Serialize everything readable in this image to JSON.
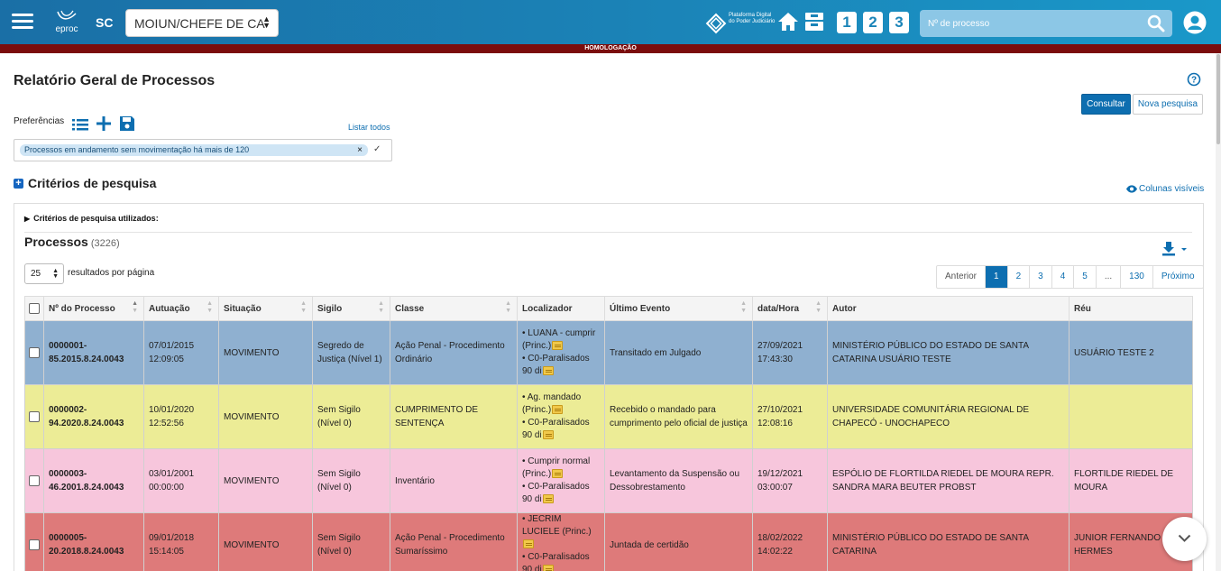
{
  "header": {
    "logo_text": "eproc",
    "uf": "SC",
    "profile_select": "MOIUN/CHEFE DE CA",
    "pdpj_text": "Plataforma Digital do Poder Judiciário",
    "shortcuts": [
      "1",
      "2",
      "3"
    ],
    "search_placeholder": "Nº de processo",
    "environment_banner": "HOMOLOGAÇÃO"
  },
  "page": {
    "title": "Relatório Geral de Processos",
    "consultar_label": "Consultar",
    "nova_pesquisa_label": "Nova pesquisa",
    "preferencias_label": "Preferências",
    "listar_todos": "Listar todos",
    "selected_preference": "Processos em andamento sem movimentação há mais de 120",
    "criterios_title": "Critérios de pesquisa",
    "colunas_visiveis": "Colunas visíveis",
    "criterios_utilizados": "Critérios de pesquisa utilizados:"
  },
  "list": {
    "title": "Processos",
    "count": "(3226)",
    "page_size": "25",
    "page_size_label": "resultados por página",
    "pagination": [
      "Anterior",
      "1",
      "2",
      "3",
      "4",
      "5",
      "...",
      "130",
      "Próximo"
    ],
    "active_page": "1"
  },
  "table": {
    "columns": [
      "Nº do Processo",
      "Autuação",
      "Situação",
      "Sigilo",
      "Classe",
      "Localizador",
      "Último Evento",
      "data/Hora",
      "Autor",
      "Réu"
    ],
    "rows": [
      {
        "color": "#8fb0d0",
        "numero": [
          "0000001-",
          "85.2015.8.24.0043"
        ],
        "autuacao": [
          "07/01/2015",
          "12:09:05"
        ],
        "situacao": "MOVIMENTO",
        "sigilo": "Segredo de Justiça (Nível 1)",
        "classe": "Ação Penal - Procedimento Ordinário",
        "localizador": [
          "• LUANA - cumprir (Princ.)",
          "• C0-Paralisados 90 di"
        ],
        "evento": "Transitado em Julgado",
        "datahora": [
          "27/09/2021",
          "17:43:30"
        ],
        "autor": "MINISTÉRIO PÚBLICO DO ESTADO DE SANTA CATARINA USUÁRIO TESTE",
        "reu": "USUÁRIO TESTE 2"
      },
      {
        "color": "#ecec96",
        "numero": [
          "0000002-",
          "94.2020.8.24.0043"
        ],
        "autuacao": [
          "10/01/2020",
          "12:52:56"
        ],
        "situacao": "MOVIMENTO",
        "sigilo": "Sem Sigilo (Nível 0)",
        "classe": "CUMPRIMENTO DE SENTENÇA",
        "localizador": [
          "• Ag. mandado (Princ.)",
          "• C0-Paralisados 90 di"
        ],
        "evento": "Recebido o mandado para cumprimento pelo oficial de justiça",
        "datahora": [
          "27/10/2021",
          "12:08:16"
        ],
        "autor": "UNIVERSIDADE COMUNITÁRIA REGIONAL DE CHAPECÓ - UNOCHAPECO",
        "reu": ""
      },
      {
        "color": "#f7c6dc",
        "numero": [
          "0000003-",
          "46.2001.8.24.0043"
        ],
        "autuacao": [
          "03/01/2001",
          "00:00:00"
        ],
        "situacao": "MOVIMENTO",
        "sigilo": "Sem Sigilo (Nível 0)",
        "classe": "Inventário",
        "localizador": [
          "• Cumprir normal (Princ.)",
          "• C0-Paralisados 90 di"
        ],
        "evento": "Levantamento da Suspensão ou Dessobrestamento",
        "datahora": [
          "19/12/2021",
          "03:00:07"
        ],
        "autor": "ESPÓLIO DE FLORTILDA RIEDEL DE MOURA REPR. SANDRA MARA BEUTER PROBST",
        "reu": "FLORTILDE RIEDEL DE MOURA"
      },
      {
        "color": "#de7a7a",
        "numero": [
          "0000005-",
          "20.2018.8.24.0043"
        ],
        "autuacao": [
          "09/01/2018",
          "15:14:05"
        ],
        "situacao": "MOVIMENTO",
        "sigilo": "Sem Sigilo (Nível 0)",
        "classe": "Ação Penal - Procedimento Sumaríssimo",
        "localizador": [
          "• JECRIM LUCIELE (Princ.)",
          "• C0-Paralisados 90 di"
        ],
        "evento": "Juntada de certidão",
        "datahora": [
          "18/02/2022",
          "14:02:22"
        ],
        "autor": "MINISTÉRIO PÚBLICO DO ESTADO DE SANTA CATARINA",
        "reu": "JUNIOR FERNANDO HERMES"
      }
    ]
  }
}
